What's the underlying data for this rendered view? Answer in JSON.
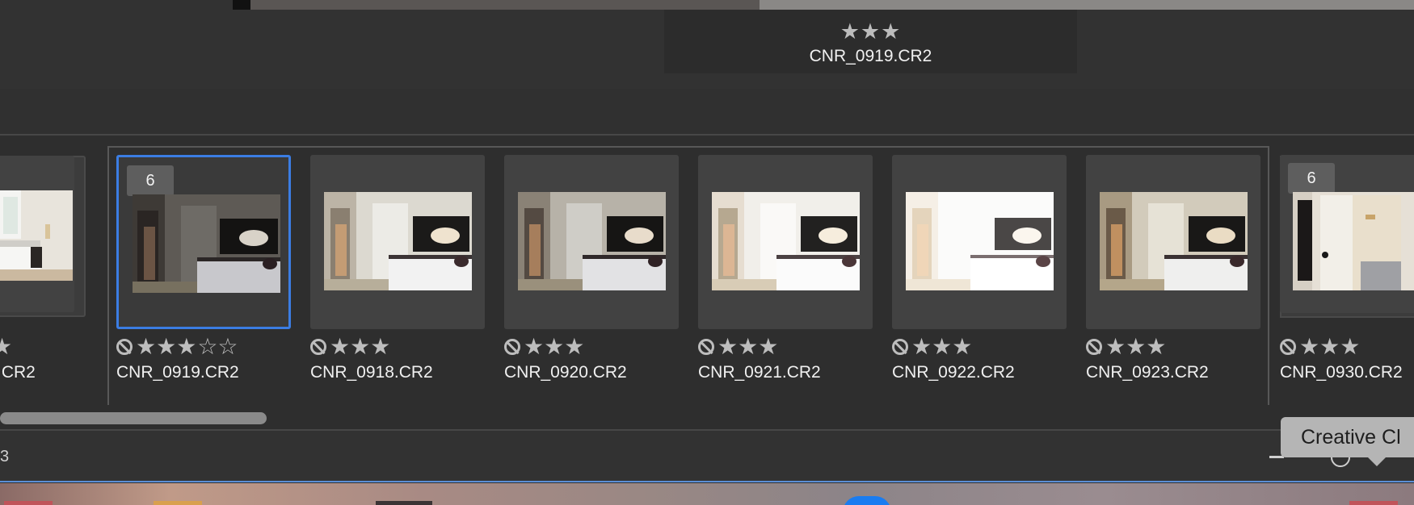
{
  "preview": {
    "stars": "★★★",
    "filename": "CNR_0919.CR2"
  },
  "filmstrip": {
    "items": [
      {
        "filename": ".CR2",
        "stars": "★",
        "empty_stars": "",
        "badge": ""
      },
      {
        "filename": "CNR_0919.CR2",
        "stars": "★★★",
        "empty_stars": "☆☆",
        "badge": "6"
      },
      {
        "filename": "CNR_0918.CR2",
        "stars": "★★★",
        "empty_stars": "",
        "badge": ""
      },
      {
        "filename": "CNR_0920.CR2",
        "stars": "★★★",
        "empty_stars": "",
        "badge": ""
      },
      {
        "filename": "CNR_0921.CR2",
        "stars": "★★★",
        "empty_stars": "",
        "badge": ""
      },
      {
        "filename": "CNR_0922.CR2",
        "stars": "★★★",
        "empty_stars": "",
        "badge": ""
      },
      {
        "filename": "CNR_0923.CR2",
        "stars": "★★★",
        "empty_stars": "",
        "badge": ""
      },
      {
        "filename": "CNR_0930.CR2",
        "stars": "★★★",
        "empty_stars": "",
        "badge": "6"
      }
    ]
  },
  "bottom_bar": {
    "left_text": "3"
  },
  "tooltip": {
    "text": "Creative Cl"
  },
  "colors": {
    "selection": "#3b7de3",
    "panel_line": "#5b8fd6"
  }
}
